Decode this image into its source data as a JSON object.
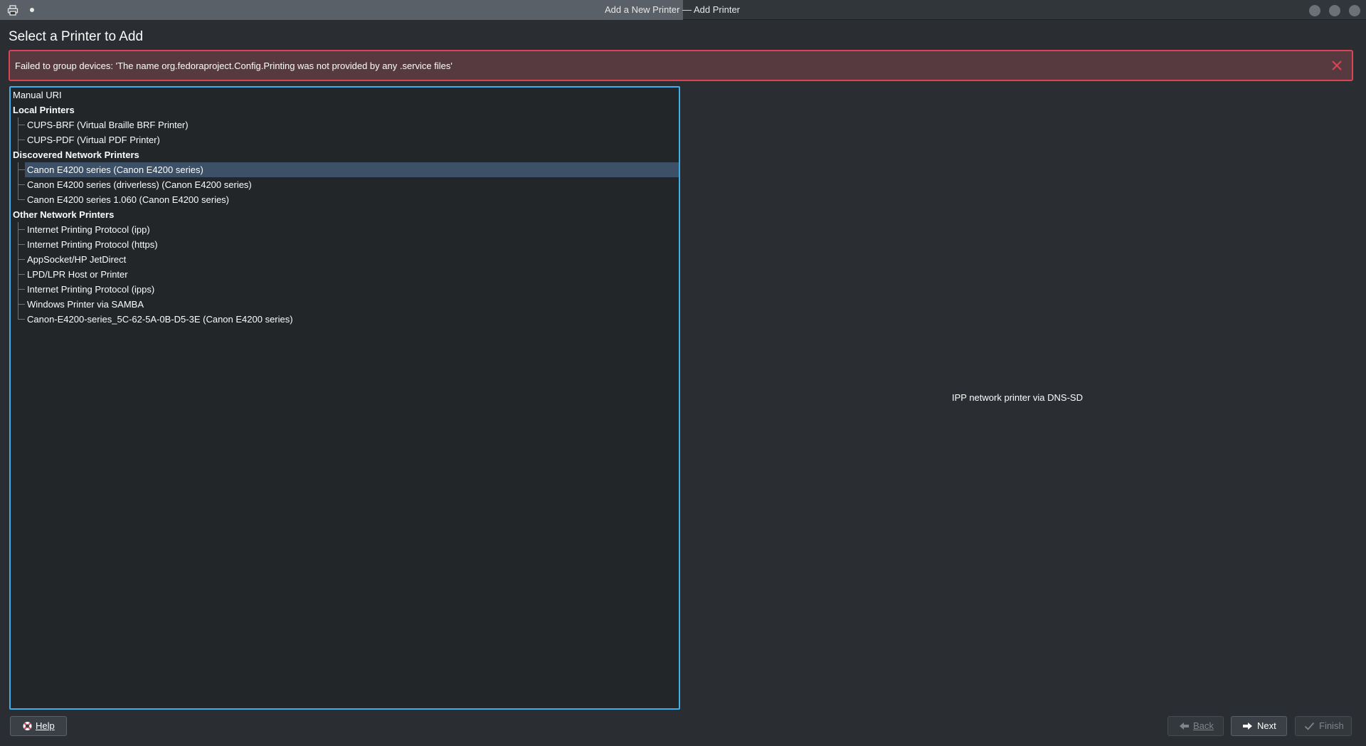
{
  "window": {
    "title": "Add a New Printer — Add Printer",
    "app_icon": "printer-icon",
    "pin_icon": "pin-dot-icon",
    "controls": [
      "minimize-icon",
      "maximize-icon",
      "close-icon"
    ]
  },
  "page": {
    "title": "Select a Printer to Add"
  },
  "error": {
    "message": "Failed to group devices: 'The name org.fedoraproject.Config.Printing was not provided by any .service files'",
    "close_icon": "close-icon",
    "color": "#da4453"
  },
  "devices": {
    "manual": "Manual URI",
    "local": {
      "label": "Local Printers",
      "items": [
        "CUPS-BRF (Virtual Braille BRF Printer)",
        "CUPS-PDF (Virtual PDF Printer)"
      ]
    },
    "discovered": {
      "label": "Discovered Network Printers",
      "items": [
        "Canon E4200 series (Canon E4200 series)",
        "Canon E4200 series (driverless) (Canon E4200 series)",
        "Canon E4200 series 1.060 (Canon E4200 series)"
      ],
      "selected_index": 0
    },
    "other": {
      "label": "Other Network Printers",
      "items": [
        "Internet Printing Protocol (ipp)",
        "Internet Printing Protocol (https)",
        "AppSocket/HP JetDirect",
        "LPD/LPR Host or Printer",
        "Internet Printing Protocol (ipps)",
        "Windows Printer via SAMBA",
        "Canon-E4200-series_5C-62-5A-0B-D5-3E (Canon E4200 series)"
      ]
    }
  },
  "description": "IPP network printer via DNS-SD",
  "buttons": {
    "help": "Help",
    "back": "Back",
    "next": "Next",
    "finish": "Finish"
  },
  "colors": {
    "accent": "#3daee9",
    "selection": "#3c5068",
    "background": "#2a2e32"
  }
}
